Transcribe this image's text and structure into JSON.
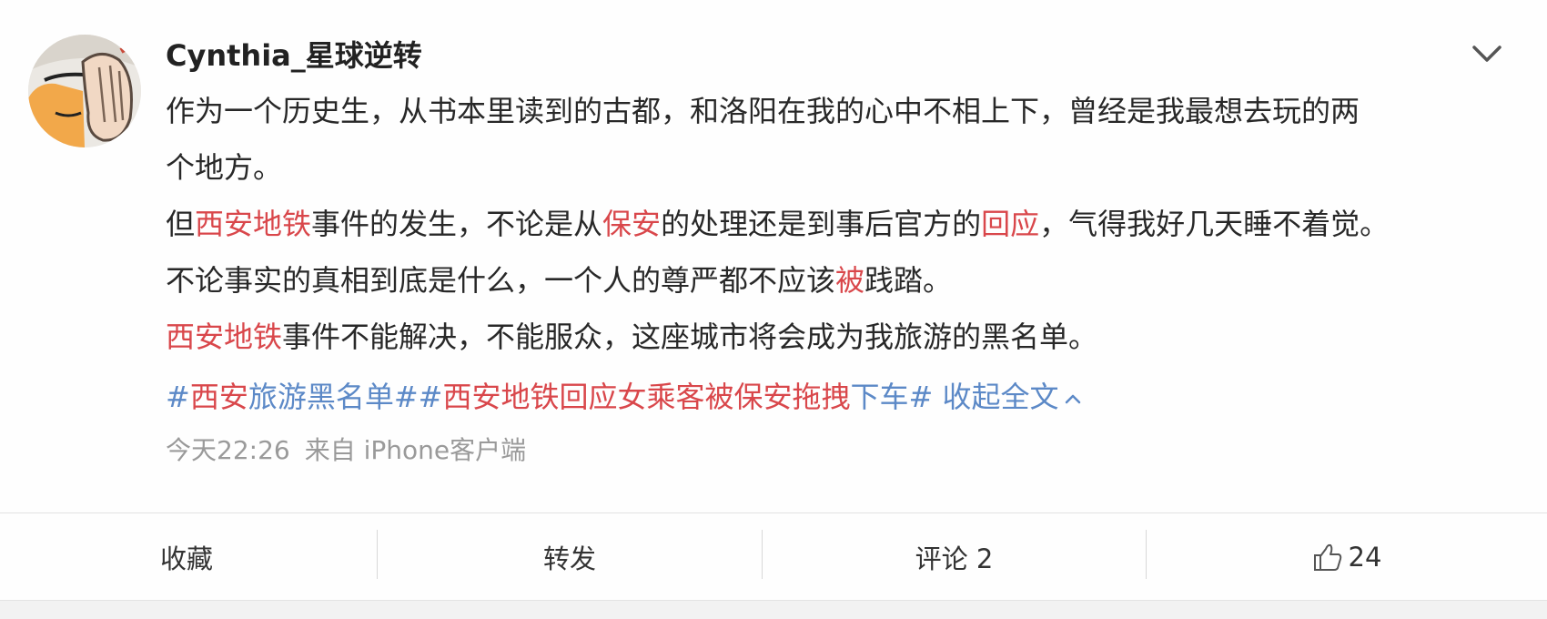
{
  "post": {
    "username": "Cynthia_星球逆转",
    "text_lines": [
      [
        {
          "t": "作为一个历史生，从书本里读到的古都，和洛阳在我的心中不相上下，曾经是我最想去玩的两",
          "c": ""
        }
      ],
      [
        {
          "t": "个地方。",
          "c": ""
        }
      ],
      [
        {
          "t": "但",
          "c": ""
        },
        {
          "t": "西安地铁",
          "c": "red"
        },
        {
          "t": "事件的发生，不论是从",
          "c": ""
        },
        {
          "t": "保安",
          "c": "red"
        },
        {
          "t": "的处理还是到事后官方的",
          "c": ""
        },
        {
          "t": "回应",
          "c": "red"
        },
        {
          "t": "，气得我好几天睡不着觉。",
          "c": ""
        }
      ],
      [
        {
          "t": "不论事实的真相到底是什么，一个人的尊严都不应该",
          "c": ""
        },
        {
          "t": "被",
          "c": "red"
        },
        {
          "t": "践踏。",
          "c": ""
        }
      ],
      [
        {
          "t": "西安地铁",
          "c": "red"
        },
        {
          "t": "事件不能解决，不能服众，这座城市将会成为我旅游的黑名单。",
          "c": ""
        }
      ]
    ],
    "tags": [
      [
        {
          "t": "#",
          "c": "blue"
        },
        {
          "t": "西安",
          "c": "red"
        },
        {
          "t": "旅游黑名单#",
          "c": "blue"
        }
      ],
      [
        {
          "t": "#",
          "c": "blue"
        },
        {
          "t": "西安地铁回应女乘客被保安拖拽",
          "c": "red"
        },
        {
          "t": "下车#",
          "c": "blue"
        }
      ]
    ],
    "collapse_label": "收起全文",
    "time": "今天22:26",
    "source": "来自 iPhone客户端"
  },
  "actions": {
    "favorite": "收藏",
    "forward": "转发",
    "comment": "评论 2",
    "like_count": "24"
  },
  "icons": {
    "more": "chevron-down-icon",
    "collapse": "caret-up-icon",
    "like": "thumbs-up-icon"
  },
  "colors": {
    "keyword_red": "#d9474b",
    "link_blue": "#5c89c7",
    "meta_gray": "#9a9a9a"
  }
}
